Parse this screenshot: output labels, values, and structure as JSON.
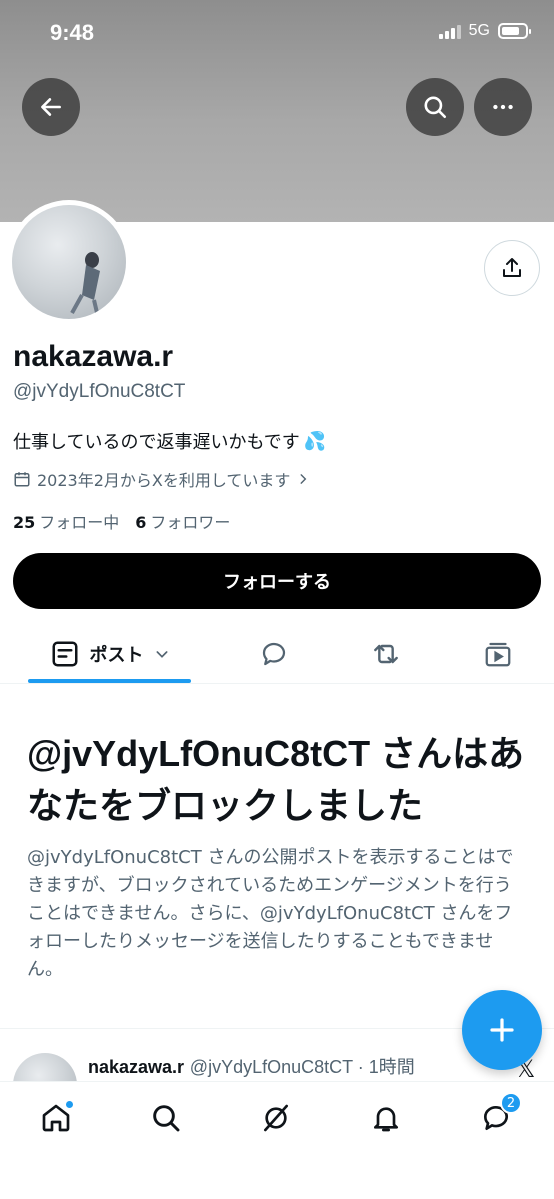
{
  "status_bar": {
    "time": "9:48",
    "network": "5G"
  },
  "profile": {
    "display_name": "nakazawa.r",
    "handle": "@jvYdyLfOnuC8tCT",
    "bio": "仕事しているので返事遅いかもです",
    "bio_emoji": "💦",
    "joined": "2023年2月からXを利用しています",
    "following_count": "25",
    "following_label": "フォロー中",
    "followers_count": "6",
    "followers_label": "フォロワー",
    "follow_button": "フォローする"
  },
  "tabs": {
    "posts_label": "ポスト"
  },
  "blocked": {
    "title": "@jvYdyLfOnuC8tCT さんはあなたをブロックしました",
    "description": "@jvYdyLfOnuC8tCT さんの公開ポストを表示することはできますが、ブロックされているためエンゲージメントを行うことはできません。さらに、@jvYdyLfOnuC8tCT さんをフォローしたりメッセージを送信したりすることもできません。"
  },
  "post_preview": {
    "name": "nakazawa.r",
    "handle_time": "@jvYdyLfOnuC8tCT · 1時間",
    "logo": "𝕏"
  },
  "bottom_nav": {
    "messages_badge": "2"
  },
  "colors": {
    "accent": "#1d9bf0",
    "text": "#0f1419",
    "secondary": "#536471"
  }
}
